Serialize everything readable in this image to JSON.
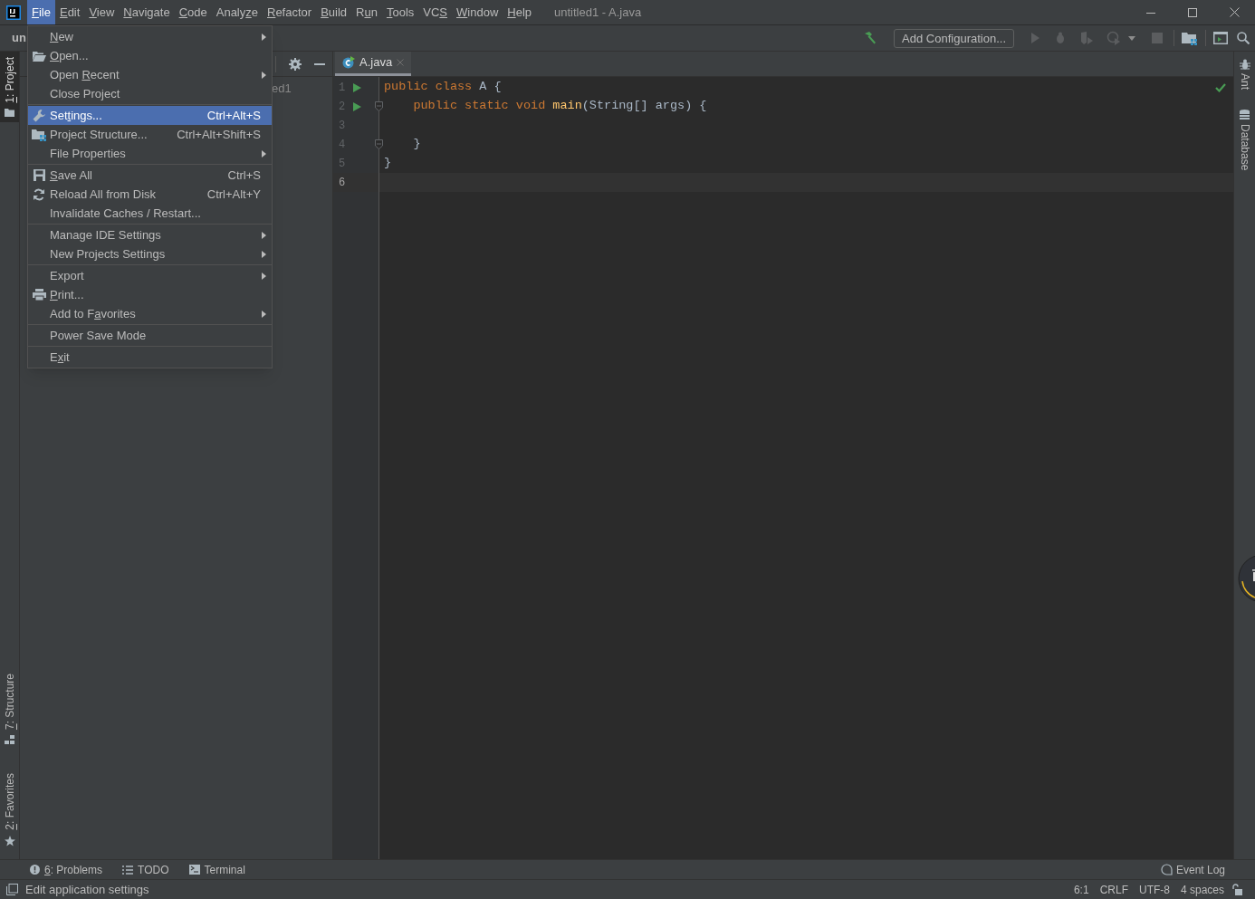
{
  "window": {
    "title": "untitled1 - A.java"
  },
  "menu_bar": [
    {
      "key": "F",
      "post": "ile",
      "selected": true
    },
    {
      "key": "E",
      "post": "dit",
      "selected": false
    },
    {
      "key": "V",
      "post": "iew",
      "selected": false
    },
    {
      "key": "N",
      "post": "avigate",
      "selected": false
    },
    {
      "key": "C",
      "post": "ode",
      "selected": false
    },
    {
      "pre": "Analy",
      "key": "z",
      "post": "e",
      "selected": false
    },
    {
      "key": "R",
      "post": "efactor",
      "selected": false
    },
    {
      "key": "B",
      "post": "uild",
      "selected": false
    },
    {
      "pre": "R",
      "key": "u",
      "post": "n",
      "selected": false
    },
    {
      "key": "T",
      "post": "ools",
      "selected": false
    },
    {
      "pre": "VC",
      "key": "S",
      "selected": false
    },
    {
      "key": "W",
      "post": "indow",
      "selected": false
    },
    {
      "key": "H",
      "post": "elp",
      "selected": false
    }
  ],
  "file_menu": [
    {
      "kind": "item",
      "key": "N",
      "post": "ew",
      "submenu": true,
      "selected": false
    },
    {
      "kind": "item",
      "key": "O",
      "post": "pen...",
      "submenu": false,
      "selected": false
    },
    {
      "kind": "item",
      "pre": "Open ",
      "key": "R",
      "post": "ecent",
      "submenu": true,
      "selected": false
    },
    {
      "kind": "item",
      "pre": "Close Project",
      "submenu": false,
      "selected": false
    },
    {
      "kind": "separator"
    },
    {
      "kind": "item",
      "pre": "Set",
      "key": "t",
      "post": "ings...",
      "shortcut": "Ctrl+Alt+S",
      "submenu": false,
      "selected": true
    },
    {
      "kind": "item",
      "pre": "Project Structure...",
      "shortcut": "Ctrl+Alt+Shift+S",
      "submenu": false,
      "selected": false
    },
    {
      "kind": "item",
      "pre": "File Properties",
      "submenu": true,
      "selected": false
    },
    {
      "kind": "separator"
    },
    {
      "kind": "item",
      "key": "S",
      "post": "ave All",
      "shortcut": "Ctrl+S",
      "submenu": false,
      "selected": false
    },
    {
      "kind": "item",
      "pre": "Reload All from Disk",
      "shortcut": "Ctrl+Alt+Y",
      "submenu": false,
      "selected": false
    },
    {
      "kind": "item",
      "pre": "Invalidate Caches / Restart...",
      "submenu": false,
      "selected": false
    },
    {
      "kind": "separator"
    },
    {
      "kind": "item",
      "pre": "Manage IDE Settings",
      "submenu": true,
      "selected": false
    },
    {
      "kind": "item",
      "pre": "New Projects Settings",
      "submenu": true,
      "selected": false
    },
    {
      "kind": "separator"
    },
    {
      "kind": "item",
      "pre": "Export",
      "submenu": true,
      "selected": false
    },
    {
      "kind": "item",
      "key": "P",
      "post": "rint...",
      "submenu": false,
      "selected": false
    },
    {
      "kind": "item",
      "pre": "Add to F",
      "key": "a",
      "post": "vorites",
      "submenu": true,
      "selected": false
    },
    {
      "kind": "separator"
    },
    {
      "kind": "item",
      "pre": "Power Save Mode",
      "submenu": false,
      "selected": false
    },
    {
      "kind": "separator"
    },
    {
      "kind": "item",
      "pre": "E",
      "key": "x",
      "post": "it",
      "submenu": false,
      "selected": false
    }
  ],
  "toolbar": {
    "breadcrumb": "un",
    "run_config": "Add Configuration..."
  },
  "left_top_tabs": [
    {
      "key": "1",
      "post": ": Project",
      "selected": true
    }
  ],
  "left_bottom_tabs": [
    {
      "key": "7",
      "post": ": Structure",
      "selected": false
    },
    {
      "key": "2",
      "post": ": Favorites",
      "selected": false
    }
  ],
  "project_panel": {
    "tree_text": "ed1"
  },
  "editor": {
    "tabs": [
      {
        "label": "A.java",
        "selected": true
      }
    ],
    "lines": [
      {
        "number": "1",
        "run": true,
        "fold": false,
        "current": false,
        "tokens": [
          {
            "kind": "keyword",
            "text": "public class "
          },
          {
            "kind": "plain",
            "text": "A {"
          }
        ]
      },
      {
        "number": "2",
        "run": true,
        "fold": true,
        "current": false,
        "tokens": [
          {
            "kind": "keyword",
            "text": "    public static void "
          },
          {
            "kind": "method",
            "text": "main"
          },
          {
            "kind": "plain",
            "text": "(String[] args) {"
          }
        ]
      },
      {
        "number": "3",
        "run": false,
        "fold": false,
        "current": false
      },
      {
        "number": "4",
        "run": false,
        "fold": true,
        "current": false,
        "tokens": [
          {
            "kind": "plain",
            "text": "    }"
          }
        ]
      },
      {
        "number": "5",
        "run": false,
        "fold": false,
        "current": false,
        "tokens": [
          {
            "kind": "plain",
            "text": "}"
          }
        ]
      },
      {
        "number": "6",
        "run": false,
        "fold": false,
        "current": true
      }
    ]
  },
  "right_tabs": [
    {
      "label": "Ant"
    },
    {
      "label": "Database"
    }
  ],
  "tool_windows": [
    {
      "key": "6",
      "post": ": Problems"
    },
    {
      "pre": "TODO"
    },
    {
      "pre": "Terminal"
    }
  ],
  "event_log": "Event Log",
  "status_bar": {
    "message": "Edit application settings",
    "items": [
      "6:1",
      "CRLF",
      "UTF-8",
      "4 spaces"
    ]
  }
}
